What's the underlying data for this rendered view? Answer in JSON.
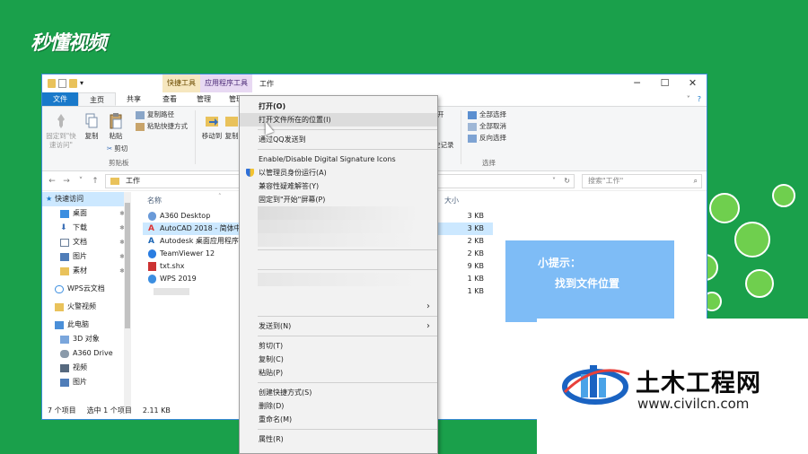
{
  "brand": {
    "logo_text": "秒懂视频"
  },
  "window": {
    "context_tab_1": "快捷工具",
    "context_tab_2": "应用程序工具",
    "title": "工作",
    "controls": {
      "min": "─",
      "max": "☐",
      "close": "✕"
    }
  },
  "tabs": [
    {
      "label": "文件"
    },
    {
      "label": "主页"
    },
    {
      "label": "共享"
    },
    {
      "label": "查看"
    },
    {
      "label": "管理"
    },
    {
      "label": "管理"
    }
  ],
  "tabs_right": {
    "collapse": "˅",
    "help": "?"
  },
  "ribbon": {
    "pin_label": "固定到\"快\n速访问\"",
    "copy_label": "复制",
    "paste_label": "粘贴",
    "copy_path": "复制路径",
    "paste_shortcut": "粘贴快捷方式",
    "cut": "剪切",
    "group_clipboard": "剪贴板",
    "move_to": "移动到",
    "copy_to": "复制",
    "open_partial": "开",
    "history_partial": "史记录",
    "select_all": "全部选择",
    "select_none": "全部取消",
    "invert": "反向选择",
    "group_select": "选择"
  },
  "address": {
    "back": "←",
    "forward": "→",
    "down": "˅",
    "up": "↑",
    "path": "工作",
    "dropdown": "˅",
    "refresh": "↻",
    "search_placeholder": "搜索\"工作\"",
    "search_icon": "⌕"
  },
  "nav": [
    {
      "label": "快速访问",
      "selected": true,
      "pin": false
    },
    {
      "label": "桌面",
      "pin": true
    },
    {
      "label": "下载",
      "pin": true
    },
    {
      "label": "文档",
      "pin": true
    },
    {
      "label": "图片",
      "pin": true
    },
    {
      "label": "素材",
      "pin": true
    },
    {
      "label": "WPS云文档",
      "pin": false
    },
    {
      "label": "火警视频",
      "pin": false
    },
    {
      "label": "此电脑",
      "pin": false
    },
    {
      "label": "3D 对象",
      "pin": false
    },
    {
      "label": "A360 Drive",
      "pin": false
    },
    {
      "label": "视频",
      "pin": false
    },
    {
      "label": "图片",
      "pin": false
    }
  ],
  "nav_pin_glyph": "✱",
  "list": {
    "col_name": "名称",
    "col_size": "大小",
    "files": [
      {
        "name": "A360 Desktop",
        "size": "3 KB"
      },
      {
        "name": "AutoCAD 2018 - 简体中",
        "size": "3 KB",
        "selected": true
      },
      {
        "name": "Autodesk 桌面应用程序",
        "size": "2 KB"
      },
      {
        "name": "TeamViewer 12",
        "size": "2 KB"
      },
      {
        "name": "txt.shx",
        "size": "9 KB"
      },
      {
        "name": "WPS 2019",
        "size": "1 KB"
      },
      {
        "name": "",
        "size": "1 KB"
      }
    ]
  },
  "status": {
    "count": "7 个项目",
    "selected": "选中 1 个项目",
    "size": "2.11 KB"
  },
  "context_menu": {
    "open": "打开(O)",
    "open_location": "打开文件所在的位置(I)",
    "send_qq": "通过QQ发送到",
    "signature": "Enable/Disable Digital Signature Icons",
    "run_admin": "以管理员身份运行(A)",
    "compat": "兼容性疑难解答(Y)",
    "pin_start": "固定到\"开始\"屏幕(P)",
    "send_to": "发送到(N)",
    "cut": "剪切(T)",
    "copy": "复制(C)",
    "paste": "粘贴(P)",
    "shortcut": "创建快捷方式(S)",
    "delete": "删除(D)",
    "rename": "重命名(M)",
    "properties": "属性(R)",
    "submenu_arrow": "›"
  },
  "tip": {
    "line1": "小提示：",
    "line2": "找到文件位置"
  },
  "watermark": {
    "name": "土木工程网",
    "url": "www.civilcn.com"
  },
  "colors": {
    "bg": "#1aa04b",
    "accent": "#1979ca",
    "tip": "#7ebcf6",
    "selection": "#cce8ff"
  }
}
